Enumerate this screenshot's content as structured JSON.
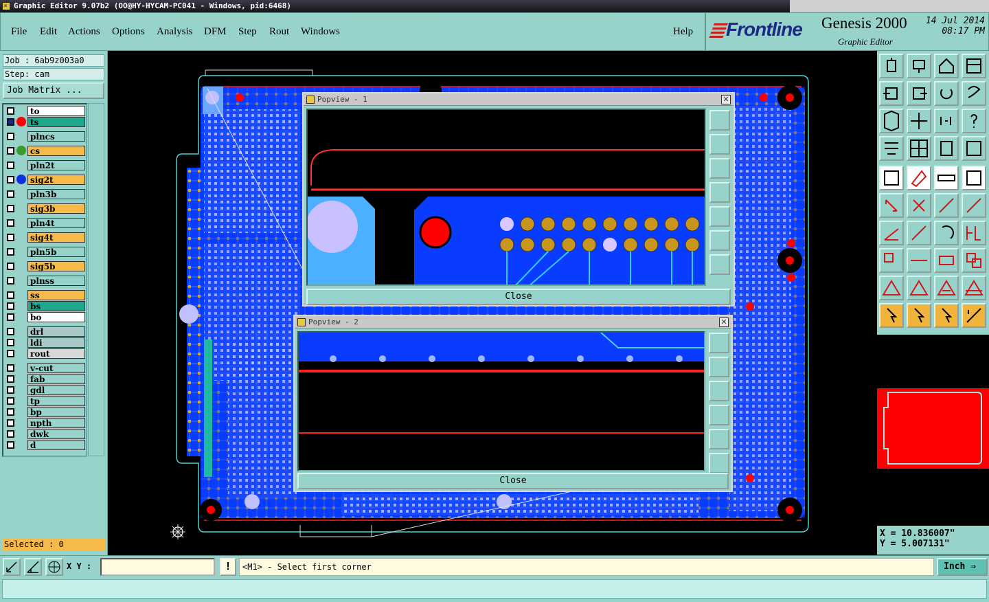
{
  "window": {
    "title": "Graphic Editor 9.07b2 (OO@HY-HYCAM-PC041 - Windows, pid:6468)"
  },
  "menu": [
    "File",
    "Edit",
    "Actions",
    "Options",
    "Analysis",
    "DFM",
    "Step",
    "Rout",
    "Windows"
  ],
  "help_label": "Help",
  "brand": {
    "logo": "Frontline",
    "product": "Genesis 2000",
    "subtitle": "Graphic Editor",
    "date": "14 Jul 2014",
    "time": "08:17 PM"
  },
  "job": {
    "job_label": "Job : 6ab9z003a0",
    "step_label": "Step: cam",
    "matrix_button": "Job Matrix ..."
  },
  "layers": [
    {
      "name": "to",
      "color": "#ffffff",
      "dot": null
    },
    {
      "name": "ts",
      "color": "#1fa88e",
      "dot": "#ff0000",
      "active": true
    },
    {
      "name": "plncs",
      "color": "#98d3cb",
      "dot": null
    },
    {
      "name": "cs",
      "color": "#f5ba4a",
      "dot": "#3a9a2a"
    },
    {
      "name": "pln2t",
      "color": "#98d3cb",
      "dot": null
    },
    {
      "name": "sig2t",
      "color": "#f5ba4a",
      "dot": "#1030e0"
    },
    {
      "name": "pln3b",
      "color": "#98d3cb",
      "dot": null
    },
    {
      "name": "sig3b",
      "color": "#f5ba4a",
      "dot": null
    },
    {
      "name": "pln4t",
      "color": "#98d3cb",
      "dot": null
    },
    {
      "name": "sig4t",
      "color": "#f5ba4a",
      "dot": null
    },
    {
      "name": "pln5b",
      "color": "#98d3cb",
      "dot": null
    },
    {
      "name": "sig5b",
      "color": "#f5ba4a",
      "dot": null
    },
    {
      "name": "plnss",
      "color": "#98d3cb",
      "dot": null
    },
    {
      "name": "ss",
      "color": "#f5ba4a",
      "dot": null
    },
    {
      "name": "bs",
      "color": "#1fa88e",
      "dot": null
    },
    {
      "name": "bo",
      "color": "#ffffff",
      "dot": null
    },
    {
      "name": "drl",
      "color": "#a8c8c8",
      "dot": null
    },
    {
      "name": "ldi",
      "color": "#a8c8c8",
      "dot": null
    },
    {
      "name": "rout",
      "color": "#d8d8d8",
      "dot": null
    },
    {
      "name": "v-cut",
      "color": "#98d3cb",
      "dot": null
    },
    {
      "name": "fab",
      "color": "#98d3cb",
      "dot": null
    },
    {
      "name": "gdl",
      "color": "#98d3cb",
      "dot": null
    },
    {
      "name": "tp",
      "color": "#98d3cb",
      "dot": null
    },
    {
      "name": "bp",
      "color": "#98d3cb",
      "dot": null
    },
    {
      "name": "npth",
      "color": "#98d3cb",
      "dot": null
    },
    {
      "name": "dwk",
      "color": "#98d3cb",
      "dot": null
    },
    {
      "name": "d",
      "color": "#98d3cb",
      "dot": null
    }
  ],
  "selected_status": "Selected : 0",
  "popview1": {
    "title": "Popview - 1",
    "close_label": "Close"
  },
  "popview2": {
    "title": "Popview - 2",
    "close_label": "Close"
  },
  "coords": {
    "x": "X = 10.836007\"",
    "y": "Y = 5.007131\""
  },
  "bottom": {
    "xy_label": "X Y :",
    "xy_value": "",
    "message": "<M1> - Select first corner",
    "units": "Inch"
  },
  "colors": {
    "panel": "#98d3cb",
    "board": "#0a3cff",
    "accent_red": "#ff0000",
    "gold_pad": "#c8961e"
  }
}
